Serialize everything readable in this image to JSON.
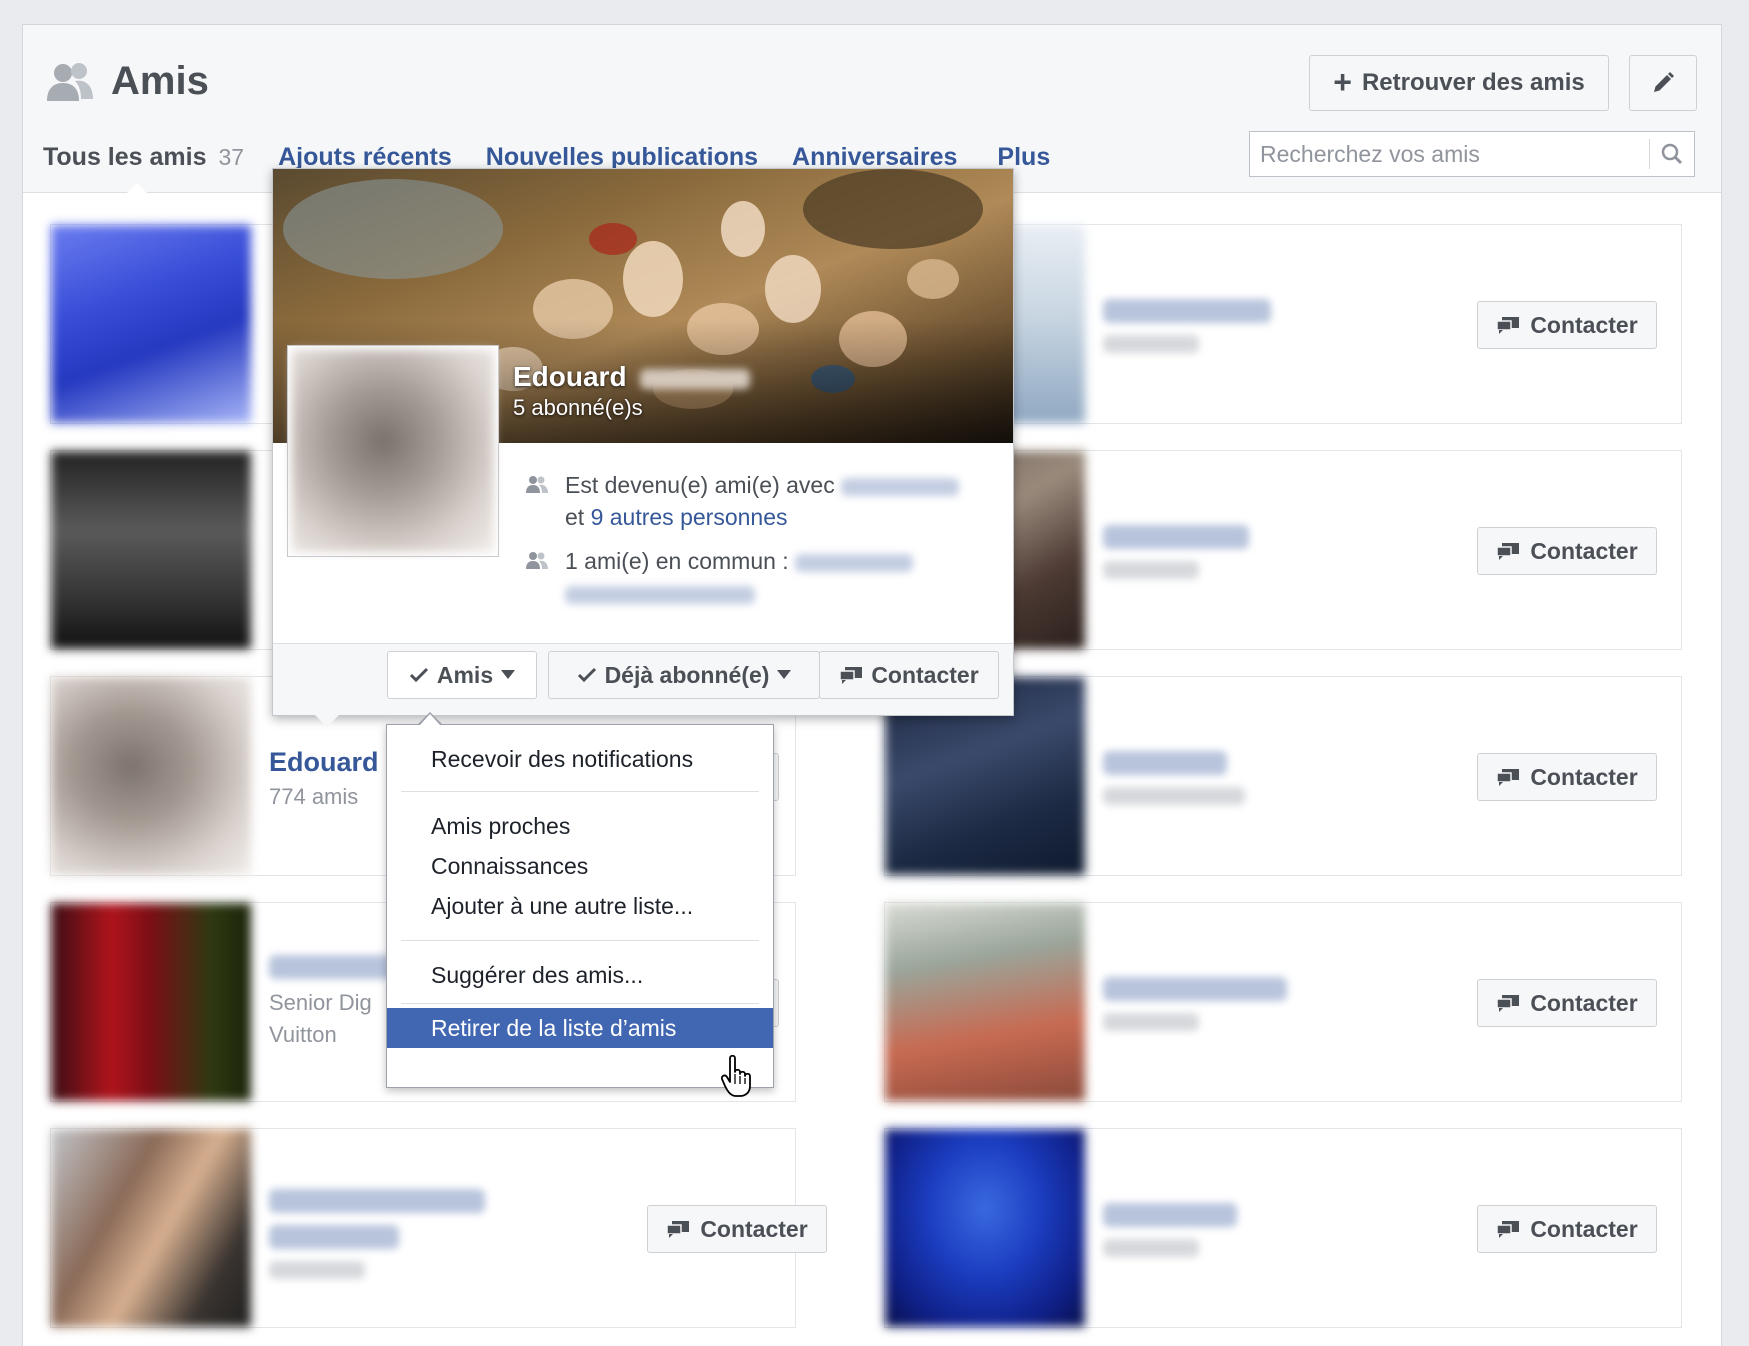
{
  "header": {
    "title": "Amis",
    "find_friends_label": "Retrouver des amis",
    "search_placeholder": "Recherchez vos amis"
  },
  "tabs": [
    {
      "label": "Tous les amis",
      "count": "37",
      "active": true
    },
    {
      "label": "Ajouts récents"
    },
    {
      "label": "Nouvelles publications"
    },
    {
      "label": "Anniversaires"
    },
    {
      "label": "Plus"
    }
  ],
  "contact_label": "Contacter",
  "cards": [
    {
      "id": "r1l"
    },
    {
      "id": "r1r"
    },
    {
      "id": "r2l"
    },
    {
      "id": "r2r"
    },
    {
      "id": "r3l",
      "name": "Edouard",
      "sub": "774 amis"
    },
    {
      "id": "r3r"
    },
    {
      "id": "r4l",
      "sub1": "Senior Dig",
      "sub2": "Vuitton"
    },
    {
      "id": "r4r"
    },
    {
      "id": "r5l"
    },
    {
      "id": "r5r"
    }
  ],
  "partial_contact": "cter",
  "hovercard": {
    "name": "Edouard",
    "followers": "5 abonné(e)s",
    "friends_with_prefix": "Est devenu(e) ami(e) avec",
    "others_prefix": "et",
    "others_link": "9 autres personnes",
    "mutual": "1 ami(e) en commun :",
    "btn_friends": "Amis",
    "btn_following": "Déjà abonné(e)",
    "btn_contact": "Contacter"
  },
  "menu": {
    "notifications": "Recevoir des notifications",
    "close_friends": "Amis proches",
    "acquaintances": "Connaissances",
    "add_to_list": "Ajouter à une autre liste...",
    "suggest": "Suggérer des amis...",
    "remove": "Retirer de la liste d’amis"
  },
  "colors": {
    "link": "#365899",
    "highlight": "#4267b2",
    "background": "#e9ebee"
  }
}
